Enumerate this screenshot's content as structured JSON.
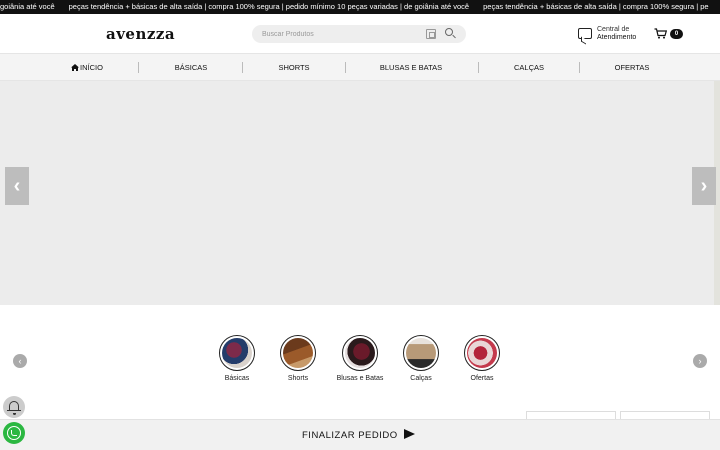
{
  "ticker": {
    "messages": [
      "goiânia até você",
      "peças tendência + básicas de alta saída | compra 100% segura | pedido mínimo 10 peças variadas | de goiânia até você",
      "peças tendência + básicas de alta saída | compra 100% segura | pe"
    ]
  },
  "header": {
    "logo": "avenzza",
    "search_placeholder": "Buscar Produtos",
    "support_line1": "Central de",
    "support_line2": "Atendimento",
    "cart_count": "0"
  },
  "nav": {
    "items": [
      "INÍCIO",
      "BÁSICAS",
      "SHORTS",
      "BLUSAS E BATAS",
      "CALÇAS",
      "OFERTAS"
    ]
  },
  "banner": {
    "prev": "‹",
    "next": "›"
  },
  "categories": {
    "items": [
      "Básicas",
      "Shorts",
      "Blusas e Batas",
      "Calças",
      "Ofertas"
    ],
    "prev": "‹",
    "next": "›"
  },
  "footer": {
    "finalize": "FINALIZAR PEDIDO"
  },
  "colors": {
    "ticker_bg": "#111111",
    "whatsapp": "#2bb741",
    "nav_bg": "#f4f4f4"
  },
  "icons": [
    "home-icon",
    "search-icon",
    "image-search-icon",
    "chat-icon",
    "cart-icon",
    "bell-icon",
    "whatsapp-icon",
    "send-icon"
  ]
}
